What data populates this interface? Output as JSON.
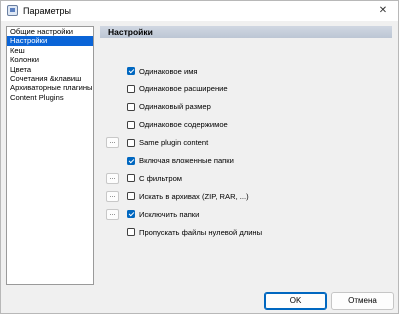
{
  "window": {
    "title": "Параметры",
    "close_glyph": "✕"
  },
  "sidebar": {
    "items": [
      {
        "label": "Общие настройки",
        "selected": false
      },
      {
        "label": "Настройки",
        "selected": true
      },
      {
        "label": "Кеш",
        "selected": false
      },
      {
        "label": "Колонки",
        "selected": false
      },
      {
        "label": "Цвета",
        "selected": false
      },
      {
        "label": "Сочетания &клавиш",
        "selected": false
      },
      {
        "label": "Архиваторные плагины",
        "selected": false
      },
      {
        "label": "Content Plugins",
        "selected": false
      }
    ]
  },
  "main": {
    "header": "Настройки",
    "options": [
      {
        "label": "Одинаковое имя",
        "checked": true,
        "has_button": false
      },
      {
        "label": "Одинаковое расширение",
        "checked": false,
        "has_button": false
      },
      {
        "label": "Одинаковый размер",
        "checked": false,
        "has_button": false
      },
      {
        "label": "Одинаковое содержимое",
        "checked": false,
        "has_button": false
      },
      {
        "label": "Same plugin content",
        "checked": false,
        "has_button": true
      },
      {
        "label": "Включая вложенные папки",
        "checked": true,
        "has_button": false
      },
      {
        "label": "С фильтром",
        "checked": false,
        "has_button": true
      },
      {
        "label": "Искать в архивах (ZIP, RAR, ...)",
        "checked": false,
        "has_button": true
      },
      {
        "label": "Исключить папки",
        "checked": true,
        "has_button": true
      },
      {
        "label": "Пропускать файлы нулевой длины",
        "checked": false,
        "has_button": false
      }
    ],
    "dots_button_label": "..."
  },
  "footer": {
    "ok_label": "OK",
    "cancel_label": "Отмена"
  },
  "colors": {
    "accent": "#0067c0",
    "selection": "#0a64d7"
  }
}
